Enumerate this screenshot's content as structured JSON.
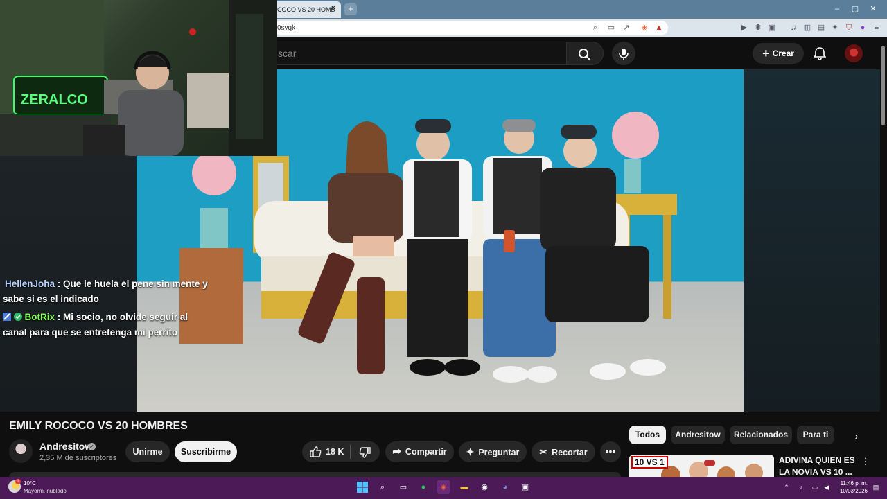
{
  "browser": {
    "tab_title": "COCO VS 20 HOMB",
    "tab_close": "✕",
    "new_tab": "+",
    "url_text": "0svqk",
    "window_controls": [
      "–",
      "▢",
      "✕"
    ],
    "toolbar_icons": [
      "zoom-icon",
      "cast-icon",
      "share-icon",
      "brave-shields-icon",
      "brave-rewards-icon",
      "media-icon",
      "extensions-icon",
      "bookmark-icon",
      "playlist-icon",
      "sidebar-icon",
      "wallet-icon",
      "vpn-icon",
      "leo-icon",
      "menu-icon"
    ]
  },
  "youtube": {
    "search_placeholder": "scar",
    "create_label": "Crear",
    "accent": "#ff0000"
  },
  "chat": [
    {
      "user": "HellenJoha",
      "message": "Que le huela el pene sin mente y sabe si es el indicado"
    },
    {
      "user": "BotRix",
      "message": "Mi socio, no olvide seguir al canal para que se entretenga mi perrito"
    }
  ],
  "video": {
    "title": "EMILY ROCOCO VS 20 HOMBRES",
    "channel": "Andresitow",
    "subscribers": "2,35 M de suscriptores",
    "join_label": "Unirme",
    "subscribe_label": "Suscribirme",
    "likes": "18 K",
    "share_label": "Compartir",
    "ask_label": "Preguntar",
    "clip_label": "Recortar"
  },
  "related": {
    "chips": [
      "Todos",
      "Andresitow",
      "Relacionados",
      "Para ti"
    ],
    "active_chip": "Todos",
    "first_item": {
      "badge": "10 VS 1",
      "title": "ADIVINA QUIEN ES LA NOVIA VS 10 ..."
    }
  },
  "taskbar": {
    "weather_temp": "10°C",
    "weather_desc": "Mayorm. nublado",
    "weather_alert_count": "1",
    "time": "11:46 p. m.",
    "date": "10/03/2026"
  }
}
